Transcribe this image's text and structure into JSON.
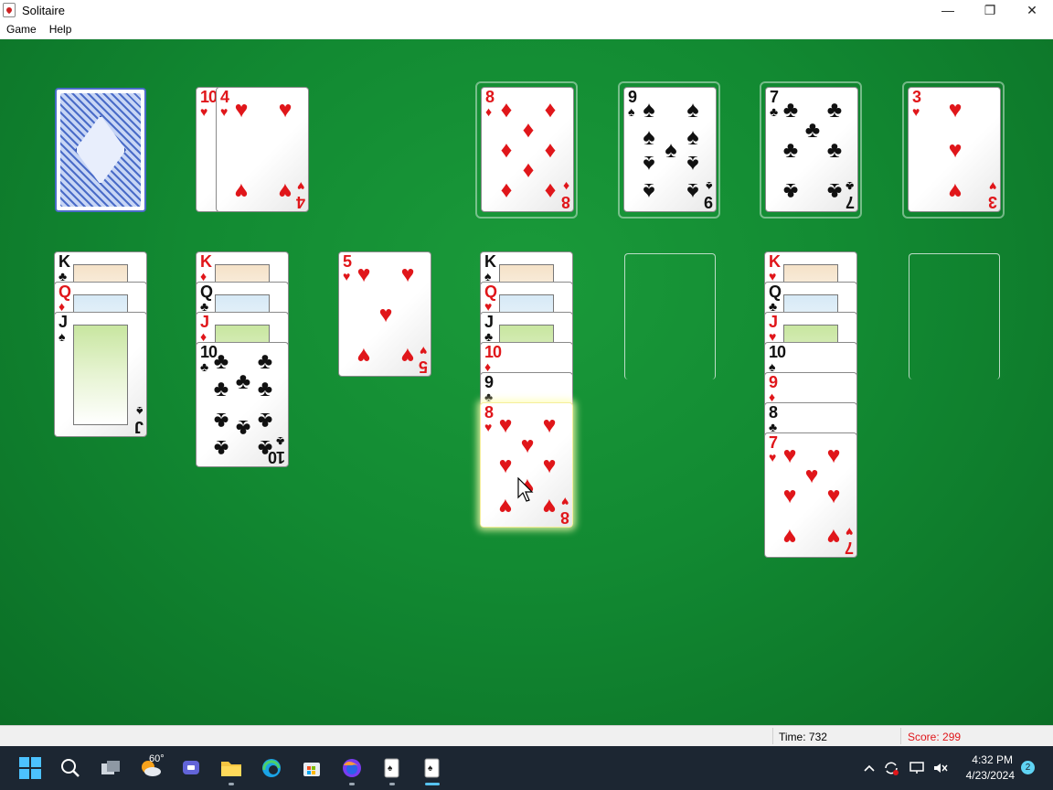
{
  "window": {
    "title": "Solitaire",
    "minimize_glyph": "—",
    "maximize_glyph": "❐",
    "close_glyph": "✕"
  },
  "menu": {
    "items": [
      "Game",
      "Help"
    ]
  },
  "stock": {
    "state": "face-down"
  },
  "waste": [
    {
      "rank": "10",
      "suit": "♥",
      "color": "red"
    },
    {
      "rank": "4",
      "suit": "♥",
      "color": "red"
    }
  ],
  "foundations": [
    {
      "rank": "8",
      "suit": "♦",
      "color": "red"
    },
    {
      "rank": "9",
      "suit": "♠",
      "color": "black"
    },
    {
      "rank": "7",
      "suit": "♣",
      "color": "black"
    },
    {
      "rank": "3",
      "suit": "♥",
      "color": "red"
    }
  ],
  "tableau": [
    [
      {
        "rank": "K",
        "suit": "♣",
        "color": "black"
      },
      {
        "rank": "Q",
        "suit": "♦",
        "color": "red"
      },
      {
        "rank": "J",
        "suit": "♠",
        "color": "black"
      }
    ],
    [
      {
        "rank": "K",
        "suit": "♦",
        "color": "red"
      },
      {
        "rank": "Q",
        "suit": "♣",
        "color": "black"
      },
      {
        "rank": "J",
        "suit": "♦",
        "color": "red"
      },
      {
        "rank": "10",
        "suit": "♣",
        "color": "black"
      }
    ],
    [
      {
        "rank": "5",
        "suit": "♥",
        "color": "red"
      }
    ],
    [
      {
        "rank": "K",
        "suit": "♠",
        "color": "black"
      },
      {
        "rank": "Q",
        "suit": "♥",
        "color": "red"
      },
      {
        "rank": "J",
        "suit": "♣",
        "color": "black"
      },
      {
        "rank": "10",
        "suit": "♦",
        "color": "red"
      },
      {
        "rank": "9",
        "suit": "♣",
        "color": "black"
      },
      {
        "rank": "8",
        "suit": "♥",
        "color": "red",
        "highlighted": true
      }
    ],
    [],
    [
      {
        "rank": "K",
        "suit": "♥",
        "color": "red"
      },
      {
        "rank": "Q",
        "suit": "♣",
        "color": "black"
      },
      {
        "rank": "J",
        "suit": "♥",
        "color": "red"
      },
      {
        "rank": "10",
        "suit": "♠",
        "color": "black"
      },
      {
        "rank": "9",
        "suit": "♦",
        "color": "red"
      },
      {
        "rank": "8",
        "suit": "♣",
        "color": "black"
      },
      {
        "rank": "7",
        "suit": "♥",
        "color": "red"
      }
    ],
    []
  ],
  "status": {
    "time": "Time:  732",
    "score": "Score: 299"
  },
  "taskbar": {
    "weather": "60°",
    "clock_time": "4:32 PM",
    "clock_date": "4/23/2024",
    "notification_count": "2"
  },
  "colors": {
    "table_green": "#128a32",
    "red_suit": "#e0161a",
    "black_suit": "#111111",
    "score_red": "#e0161a",
    "taskbar_bg": "#1c2632"
  }
}
